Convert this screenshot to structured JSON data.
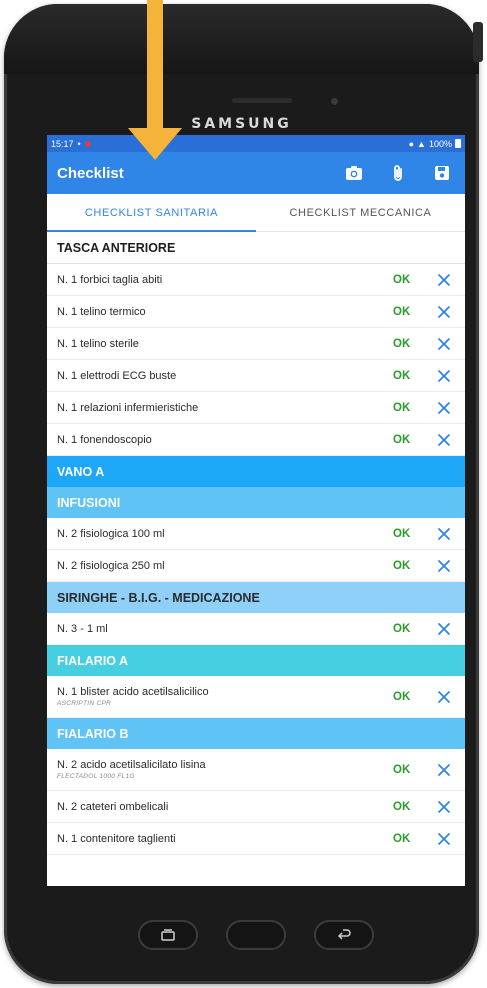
{
  "device": {
    "brand": "SAMSUNG"
  },
  "status_bar": {
    "time": "15:17",
    "battery": "100%"
  },
  "app_bar": {
    "title": "Checklist",
    "actions": [
      {
        "icon": "camera-icon"
      },
      {
        "icon": "attachment-icon"
      },
      {
        "icon": "save-icon"
      }
    ]
  },
  "tabs": [
    {
      "label": "CHECKLIST SANITARIA",
      "active": true
    },
    {
      "label": "CHECKLIST MECCANICA",
      "active": false
    }
  ],
  "sections": [
    {
      "title": "TASCA ANTERIORE",
      "style": "white",
      "items": [
        {
          "label": "N. 1 forbici taglia abiti",
          "status": "OK"
        },
        {
          "label": "N. 1 telino termico",
          "status": "OK"
        },
        {
          "label": "N. 1 telino sterile",
          "status": "OK"
        },
        {
          "label": "N. 1 elettrodi ECG buste",
          "status": "OK"
        },
        {
          "label": "N. 1 relazioni infermieristiche",
          "status": "OK"
        },
        {
          "label": "N. 1 fonendoscopio",
          "status": "OK"
        }
      ]
    },
    {
      "title": "VANO A",
      "style": "blue",
      "items": []
    },
    {
      "title": "INFUSIONI",
      "style": "light",
      "items": [
        {
          "label": "N. 2 fisiologica 100 ml",
          "status": "OK"
        },
        {
          "label": "N. 2 fisiologica 250 ml",
          "status": "OK"
        }
      ]
    },
    {
      "title": "SIRINGHE - B.I.G. - MEDICAZIONE",
      "style": "pale",
      "items": [
        {
          "label": "N. 3 - 1 ml",
          "status": "OK"
        }
      ]
    },
    {
      "title": "FIALARIO A",
      "style": "teal",
      "items": [
        {
          "label": "N. 1 blister acido acetilsalicilico",
          "sub": "ASCRIPTIN CPR",
          "status": "OK"
        }
      ]
    },
    {
      "title": "FIALARIO B",
      "style": "light",
      "items": [
        {
          "label": "N. 2 acido acetilsalicilato lisina",
          "sub": "FLECTADOL 1000 FL1G",
          "status": "OK"
        },
        {
          "label": "N. 2 cateteri ombelicali",
          "status": "OK"
        },
        {
          "label": "N. 1 contenitore taglienti",
          "status": "OK"
        }
      ]
    }
  ],
  "colors": {
    "app_bar": "#2f86e6",
    "status_bar": "#2a6fd8",
    "ok": "#2c9a2c",
    "x_icon": "#2f86e6",
    "arrow": "#f4b43a"
  }
}
